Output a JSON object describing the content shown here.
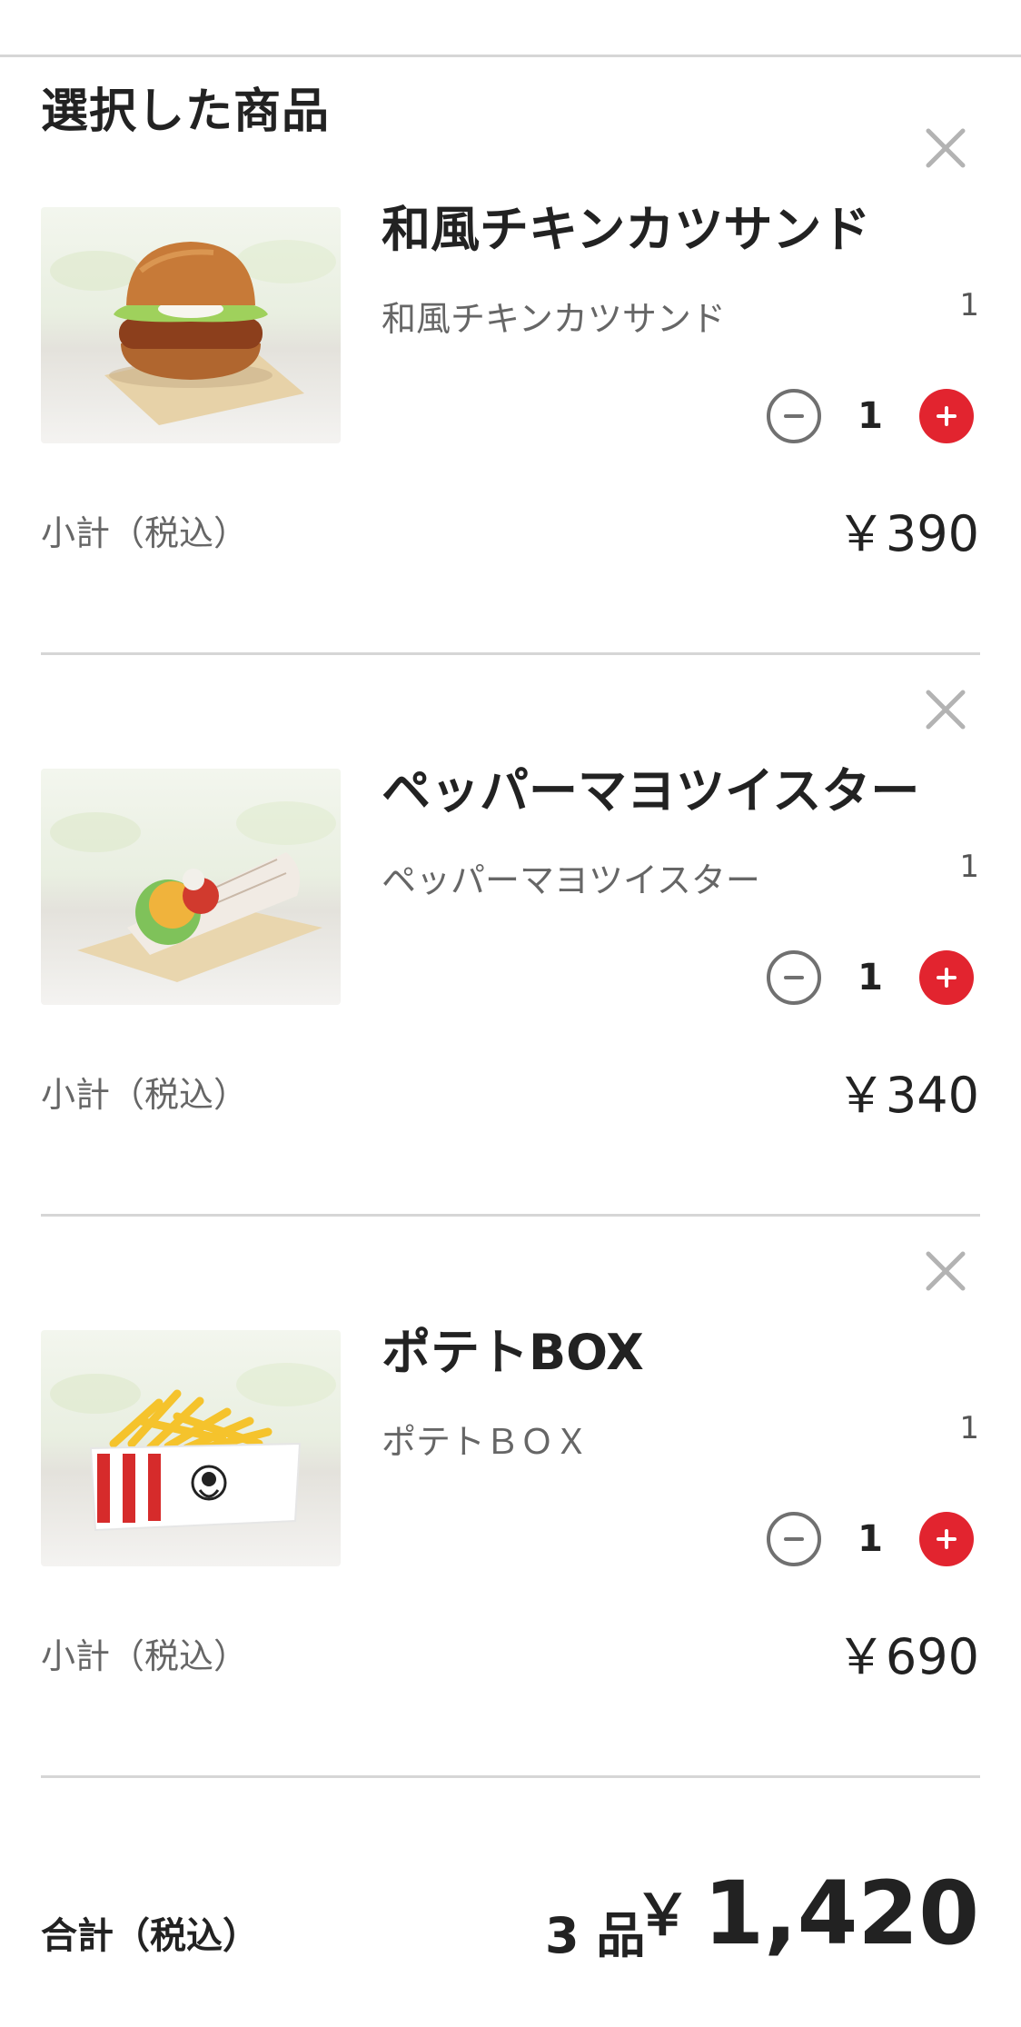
{
  "section_title": "選択した商品",
  "items": [
    {
      "name": "和風チキンカツサンド",
      "option_name": "和風チキンカツサンド",
      "option_qty": "1",
      "quantity": "1",
      "subtotal_label": "小計（税込）",
      "subtotal": "￥390",
      "image": "chicken-katsu-sandwich"
    },
    {
      "name": "ペッパーマヨツイスター",
      "option_name": "ペッパーマヨツイスター",
      "option_qty": "1",
      "quantity": "1",
      "subtotal_label": "小計（税込）",
      "subtotal": "￥340",
      "image": "pepper-mayo-twister"
    },
    {
      "name": "ポテトBOX",
      "option_name": "ポテトＢＯＸ",
      "option_qty": "1",
      "quantity": "1",
      "subtotal_label": "小計（税込）",
      "subtotal": "￥690",
      "image": "potato-box"
    }
  ],
  "total": {
    "label": "合計（税込）",
    "count": "3 品",
    "currency": "￥",
    "amount": "1,420"
  },
  "icons": {
    "remove": "close-icon",
    "minus": "minus-circle-icon",
    "plus": "plus-circle-icon"
  },
  "colors": {
    "accent": "#e2242f",
    "divider": "#d6d6d6",
    "text": "#222222",
    "muted": "#666666"
  }
}
